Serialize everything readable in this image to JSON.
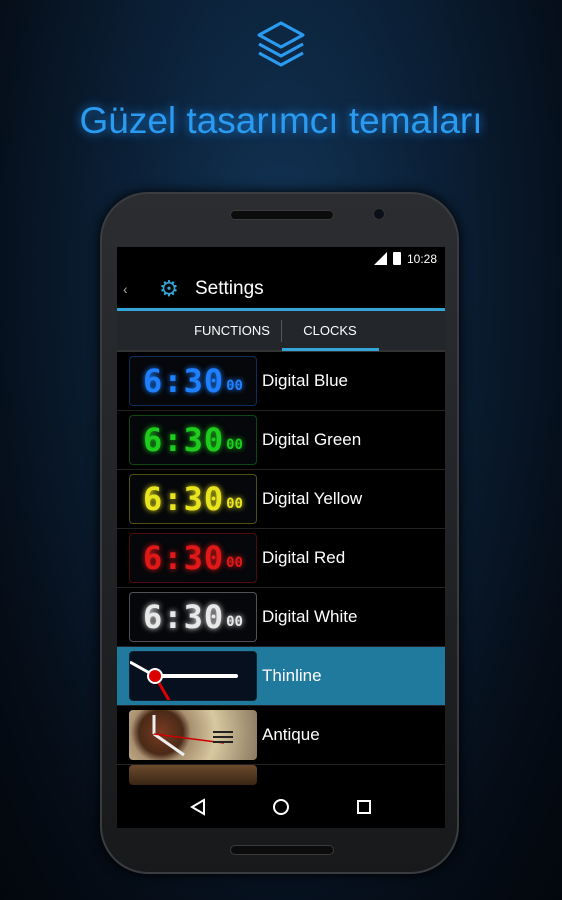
{
  "headline": "Güzel tasarımcı temaları",
  "status": {
    "time": "10:28"
  },
  "actionbar": {
    "title": "Settings"
  },
  "tabs": [
    {
      "label": "FUNCTIONS",
      "active": false
    },
    {
      "label": "CLOCKS",
      "active": true
    }
  ],
  "clock_thumb_text": {
    "time": "6:30",
    "seconds": "00"
  },
  "items": [
    {
      "label": "Digital Blue",
      "color": "#1e7fff"
    },
    {
      "label": "Digital Green",
      "color": "#1dcc1d"
    },
    {
      "label": "Digital Yellow",
      "color": "#e8e51e"
    },
    {
      "label": "Digital Red",
      "color": "#e01818"
    },
    {
      "label": "Digital White",
      "color": "#e8e8e8"
    },
    {
      "label": "Thinline",
      "selected": true
    },
    {
      "label": "Antique"
    }
  ],
  "accent": "#33a5d8"
}
